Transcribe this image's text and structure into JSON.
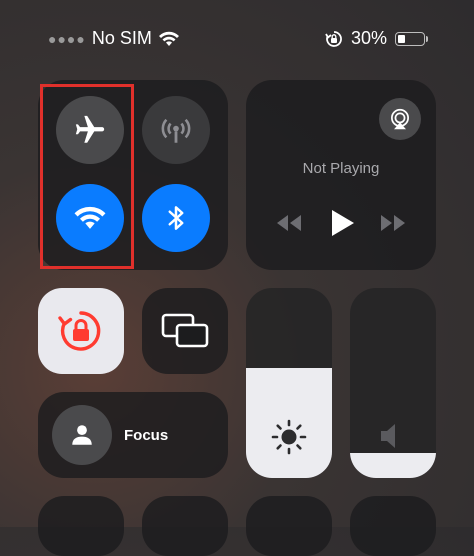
{
  "status_bar": {
    "carrier": "No SIM",
    "battery_text": "30%",
    "battery_level": 0.3
  },
  "connectivity": {
    "airplane_mode": {
      "icon": "airplane-icon",
      "enabled": false
    },
    "cellular_data": {
      "icon": "antenna-icon",
      "enabled": false
    },
    "wifi": {
      "icon": "wifi-icon",
      "enabled": true
    },
    "bluetooth": {
      "icon": "bluetooth-icon",
      "enabled": true
    }
  },
  "media": {
    "status": "Not Playing",
    "icons": [
      "airplay-icon",
      "rewind-icon",
      "play-icon",
      "fast-forward-icon"
    ]
  },
  "controls": {
    "rotation_lock": {
      "icon": "rotation-lock-icon",
      "enabled": true
    },
    "screen_mirroring": {
      "icon": "screen-mirroring-icon"
    }
  },
  "focus": {
    "label": "Focus",
    "icon": "person-icon"
  },
  "brightness": {
    "level": 0.58,
    "icon": "sun-icon"
  },
  "volume": {
    "level": 0.13,
    "icon": "speaker-icon"
  },
  "colors": {
    "accent": "#0a7cff",
    "highlight": "#e0302b",
    "lock_red": "#ff3b30"
  }
}
